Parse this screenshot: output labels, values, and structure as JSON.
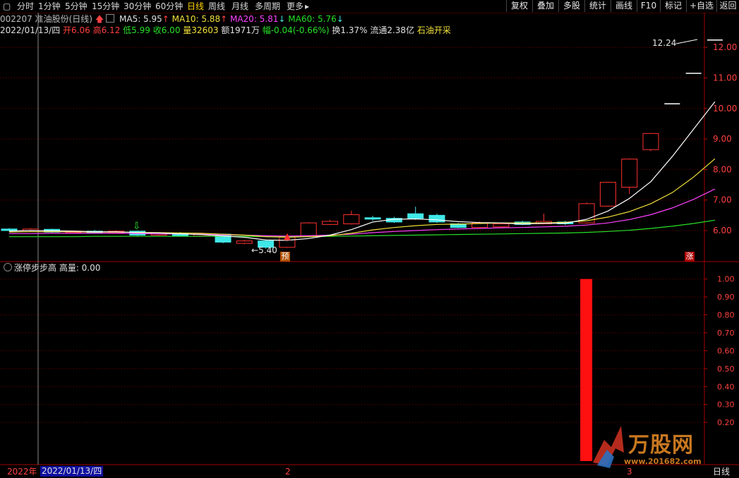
{
  "toolbar": {
    "tabs": [
      "分时",
      "1分钟",
      "5分钟",
      "15分钟",
      "30分钟",
      "60分钟",
      "日线",
      "周线",
      "月线",
      "多周期",
      "更多"
    ],
    "active_tab": "日线",
    "right_buttons": [
      "复权",
      "叠加",
      "多股",
      "统计",
      "画线",
      "F10",
      "标记",
      "+自选",
      "返回"
    ]
  },
  "stock": {
    "code_name": "002207 准油股份(日线)",
    "ma5": "MA5: 5.95",
    "ma10": "MA10: 5.88",
    "ma20": "MA20: 5.81",
    "ma60": "MA60: 5.76",
    "date": "2022/01/13/四",
    "open": "开6.06",
    "high": "高6.12",
    "low": "低5.99",
    "close": "收6.00",
    "volume": "量32603",
    "amount": "额1971万",
    "change": "幅-0.04(-0.66%)",
    "turnover": "换1.37%",
    "float": "流通2.38亿",
    "sector": "石油开采"
  },
  "price_axis": {
    "ticks": [
      "12.00",
      "11.00",
      "10.00",
      "9.00",
      "8.00",
      "7.00",
      "6.00"
    ],
    "high_label": "12.24",
    "low_label": "5.40"
  },
  "markers": {
    "pre": "预",
    "zhang": "涨"
  },
  "indicator": {
    "title": "涨停步步高 高量: 0.00",
    "ticks": [
      "1.00",
      "0.90",
      "0.80",
      "0.70",
      "0.60",
      "0.50",
      "0.40",
      "0.30",
      "0.20"
    ]
  },
  "bottom": {
    "year": "2022年",
    "date": "2022/01/13/四",
    "month_mark": "2",
    "month_mark2": "3",
    "period": "日线"
  },
  "watermark": {
    "text": "万股网",
    "url": "www.201682.com"
  },
  "colors": {
    "up": "#ff3030",
    "down": "#40e8e8",
    "ma5": "#ffffff",
    "ma10": "#f2e03a",
    "ma20": "#ff40ff",
    "ma60": "#28e028",
    "grid": "#7a0000"
  },
  "chart_data": {
    "type": "candlestick",
    "ylim": [
      5.3,
      12.5
    ],
    "candles": [
      {
        "o": 6.05,
        "c": 6.0,
        "h": 6.08,
        "l": 5.97
      },
      {
        "o": 6.0,
        "c": 6.05,
        "h": 6.08,
        "l": 5.98
      },
      {
        "o": 6.04,
        "c": 5.95,
        "h": 6.06,
        "l": 5.93
      },
      {
        "o": 5.95,
        "c": 5.98,
        "h": 6.0,
        "l": 5.93
      },
      {
        "o": 5.98,
        "c": 5.92,
        "h": 6.02,
        "l": 5.9
      },
      {
        "o": 5.92,
        "c": 5.98,
        "h": 6.01,
        "l": 5.9
      },
      {
        "o": 5.98,
        "c": 5.85,
        "h": 6.0,
        "l": 5.82
      },
      {
        "o": 5.85,
        "c": 5.92,
        "h": 5.95,
        "l": 5.83
      },
      {
        "o": 5.92,
        "c": 5.82,
        "h": 5.95,
        "l": 5.8
      },
      {
        "o": 5.82,
        "c": 5.88,
        "h": 5.92,
        "l": 5.8
      },
      {
        "o": 5.88,
        "c": 5.62,
        "h": 5.9,
        "l": 5.58
      },
      {
        "o": 5.58,
        "c": 5.66,
        "h": 5.7,
        "l": 5.55
      },
      {
        "o": 5.66,
        "c": 5.45,
        "h": 5.68,
        "l": 5.4
      },
      {
        "o": 5.45,
        "c": 5.8,
        "h": 5.85,
        "l": 5.43
      },
      {
        "o": 5.82,
        "c": 6.25,
        "h": 6.28,
        "l": 5.8
      },
      {
        "o": 6.2,
        "c": 6.3,
        "h": 6.35,
        "l": 6.18
      },
      {
        "o": 6.22,
        "c": 6.52,
        "h": 6.65,
        "l": 6.2
      },
      {
        "o": 6.42,
        "c": 6.38,
        "h": 6.48,
        "l": 6.32
      },
      {
        "o": 6.4,
        "c": 6.28,
        "h": 6.45,
        "l": 6.25
      },
      {
        "o": 6.55,
        "c": 6.4,
        "h": 6.78,
        "l": 6.35
      },
      {
        "o": 6.5,
        "c": 6.28,
        "h": 6.55,
        "l": 6.25
      },
      {
        "o": 6.22,
        "c": 6.1,
        "h": 6.25,
        "l": 6.08
      },
      {
        "o": 6.1,
        "c": 6.25,
        "h": 6.3,
        "l": 6.08
      },
      {
        "o": 6.12,
        "c": 6.22,
        "h": 6.26,
        "l": 6.1
      },
      {
        "o": 6.28,
        "c": 6.2,
        "h": 6.32,
        "l": 6.18
      },
      {
        "o": 6.22,
        "c": 6.3,
        "h": 6.55,
        "l": 6.2
      },
      {
        "o": 6.28,
        "c": 6.22,
        "h": 6.32,
        "l": 6.18
      },
      {
        "o": 6.25,
        "c": 6.88,
        "h": 6.92,
        "l": 6.22
      },
      {
        "o": 6.8,
        "c": 7.58,
        "h": 7.6,
        "l": 6.78
      },
      {
        "o": 7.42,
        "c": 8.34,
        "h": 8.36,
        "l": 7.2
      },
      {
        "o": 8.65,
        "c": 9.18,
        "h": 9.2,
        "l": 8.6
      },
      {
        "o": 10.15,
        "c": 10.15,
        "h": 10.15,
        "l": 10.15
      },
      {
        "o": 11.15,
        "c": 11.15,
        "h": 11.15,
        "l": 11.15
      },
      {
        "o": 12.24,
        "c": 12.24,
        "h": 12.24,
        "l": 12.24
      }
    ],
    "ma5": [
      5.98,
      6.0,
      5.99,
      5.98,
      5.96,
      5.96,
      5.93,
      5.92,
      5.89,
      5.87,
      5.82,
      5.78,
      5.69,
      5.68,
      5.74,
      5.85,
      6.03,
      6.28,
      6.37,
      6.38,
      6.35,
      6.29,
      6.26,
      6.25,
      6.21,
      6.24,
      6.24,
      6.37,
      6.64,
      7.05,
      7.6,
      8.42,
      9.32,
      10.22
    ],
    "ma10": [
      5.95,
      5.96,
      5.96,
      5.96,
      5.95,
      5.95,
      5.94,
      5.93,
      5.92,
      5.91,
      5.88,
      5.85,
      5.8,
      5.78,
      5.8,
      5.83,
      5.91,
      6.02,
      6.1,
      6.16,
      6.2,
      6.21,
      6.23,
      6.25,
      6.25,
      6.25,
      6.27,
      6.32,
      6.44,
      6.62,
      6.88,
      7.24,
      7.75,
      8.35
    ],
    "ma20": [
      5.9,
      5.9,
      5.91,
      5.91,
      5.91,
      5.91,
      5.9,
      5.89,
      5.89,
      5.88,
      5.86,
      5.85,
      5.83,
      5.82,
      5.83,
      5.85,
      5.88,
      5.93,
      5.97,
      6.0,
      6.03,
      6.05,
      6.07,
      6.09,
      6.1,
      6.12,
      6.14,
      6.18,
      6.25,
      6.36,
      6.52,
      6.74,
      7.02,
      7.36
    ],
    "ma60": [
      5.8,
      5.8,
      5.8,
      5.8,
      5.81,
      5.81,
      5.81,
      5.81,
      5.81,
      5.81,
      5.81,
      5.81,
      5.8,
      5.8,
      5.8,
      5.81,
      5.82,
      5.83,
      5.84,
      5.85,
      5.86,
      5.87,
      5.88,
      5.89,
      5.9,
      5.91,
      5.92,
      5.94,
      5.97,
      6.01,
      6.07,
      6.14,
      6.23,
      6.34
    ],
    "indicator_values": [
      0,
      0,
      0,
      0,
      0,
      0,
      0,
      0,
      0,
      0,
      0,
      0,
      0,
      0,
      0,
      0,
      0,
      0,
      0,
      0,
      0,
      0,
      0,
      0,
      0,
      0,
      0,
      1,
      0,
      0,
      0,
      0,
      0,
      0
    ],
    "indicator_ylim": [
      0,
      1.05
    ]
  }
}
